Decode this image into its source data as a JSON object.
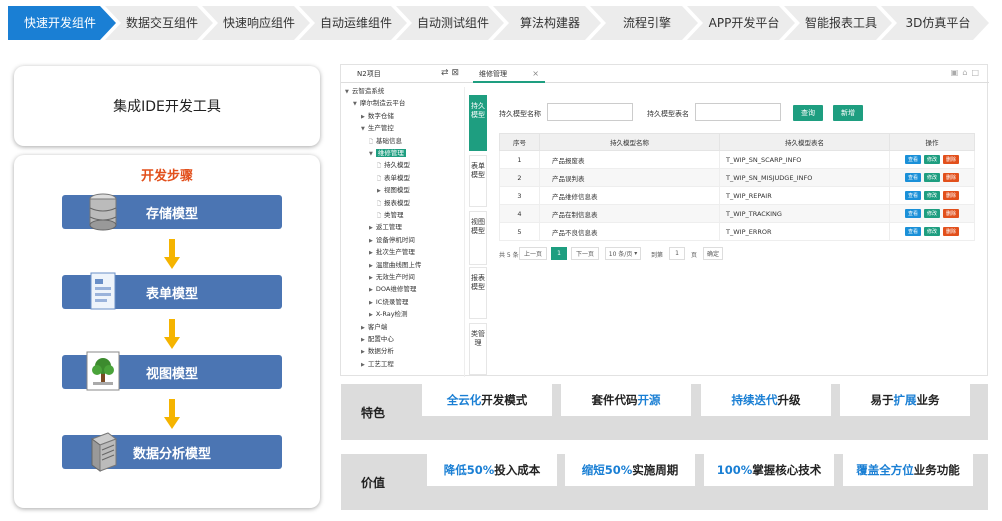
{
  "steps": [
    "快速开发组件",
    "数据交互组件",
    "快速响应组件",
    "自动运维组件",
    "自动测试组件",
    "算法构建器",
    "流程引擎",
    "APP开发平台",
    "智能报表工具",
    "3D仿真平台"
  ],
  "ide_tool": "集成IDE开发工具",
  "dev_steps": {
    "title": "开发步骤",
    "items": [
      "存储模型",
      "表单模型",
      "视图模型",
      "数据分析模型"
    ]
  },
  "ide": {
    "tree_header": "N2项目",
    "tree": [
      {
        "label": "云智造系统",
        "indent": 0,
        "arrow": "▼"
      },
      {
        "label": "摩尔制造云平台",
        "indent": 1,
        "arrow": "▼"
      },
      {
        "label": "数字仓储",
        "indent": 2,
        "arrow": "▶"
      },
      {
        "label": "生产管控",
        "indent": 2,
        "arrow": "▼"
      },
      {
        "label": "基础信息",
        "indent": 3,
        "arrow": "🗋"
      },
      {
        "label": "维修管理",
        "indent": 3,
        "arrow": "▼",
        "selected": true
      },
      {
        "label": "持久模型",
        "indent": 4,
        "arrow": "🗋"
      },
      {
        "label": "表单模型",
        "indent": 4,
        "arrow": "🗋"
      },
      {
        "label": "视图模型",
        "indent": 4,
        "arrow": "▶"
      },
      {
        "label": "报表模型",
        "indent": 4,
        "arrow": "🗋"
      },
      {
        "label": "类管理",
        "indent": 4,
        "arrow": "🗋"
      },
      {
        "label": "返工管理",
        "indent": 3,
        "arrow": "▶"
      },
      {
        "label": "设备停机时间",
        "indent": 3,
        "arrow": "▶"
      },
      {
        "label": "批次生产管理",
        "indent": 3,
        "arrow": "▶"
      },
      {
        "label": "温度曲线图上传",
        "indent": 3,
        "arrow": "▶"
      },
      {
        "label": "无效生产时间",
        "indent": 3,
        "arrow": "▶"
      },
      {
        "label": "DOA维修管理",
        "indent": 3,
        "arrow": "▶"
      },
      {
        "label": "IC烧录管理",
        "indent": 3,
        "arrow": "▶"
      },
      {
        "label": "X-Ray检测",
        "indent": 3,
        "arrow": "▶"
      },
      {
        "label": "客户端",
        "indent": 2,
        "arrow": "▶"
      },
      {
        "label": "配置中心",
        "indent": 2,
        "arrow": "▶"
      },
      {
        "label": "数据分析",
        "indent": 2,
        "arrow": "▶"
      },
      {
        "label": "工艺工程",
        "indent": 2,
        "arrow": "▶"
      }
    ],
    "tab": "维修管理",
    "vtabs": [
      "持久模型",
      "表单模型",
      "视图模型",
      "报表模型",
      "类管理"
    ],
    "query": {
      "name_label": "持久模型名称",
      "table_label": "持久模型表名",
      "search_btn": "查询",
      "add_btn": "新增"
    },
    "columns": [
      "序号",
      "持久模型名称",
      "持久模型表名",
      "操作"
    ],
    "rows": [
      {
        "no": "1",
        "name": "产品报废表",
        "table": "T_WIP_SN_SCARP_INFO"
      },
      {
        "no": "2",
        "name": "产品误判表",
        "table": "T_WIP_SN_MISJUDGE_INFO"
      },
      {
        "no": "3",
        "name": "产品维修信息表",
        "table": "T_WIP_REPAIR"
      },
      {
        "no": "4",
        "name": "产品在制信息表",
        "table": "T_WIP_TRACKING"
      },
      {
        "no": "5",
        "name": "产品不良信息表",
        "table": "T_WIP_ERROR"
      }
    ],
    "ops": {
      "view": "查看",
      "edit": "修改",
      "del": "删除"
    },
    "pager": {
      "total": "共 5 条",
      "prev": "上一页",
      "page": "1",
      "next": "下一页",
      "size": "10 条/页",
      "goto": "到第",
      "input": "1",
      "unit": "页",
      "confirm": "确定"
    }
  },
  "features": {
    "label": "特色",
    "items": [
      {
        "hl": "全云化",
        "rest": "开发模式",
        "order": "hl-first"
      },
      {
        "pre": "套件代码",
        "hl": "开源",
        "order": "hl-last"
      },
      {
        "hl": "持续迭代",
        "rest": "升级",
        "order": "hl-first"
      },
      {
        "pre": "易于",
        "hl": "扩展",
        "rest": "业务",
        "order": "mid"
      }
    ]
  },
  "values": {
    "label": "价值",
    "items": [
      {
        "pre": "",
        "hl": "降低50%",
        "rest": "投入成本"
      },
      {
        "pre": "",
        "hl": "缩短50%",
        "rest": "实施周期"
      },
      {
        "pre": "",
        "hl": "100%",
        "rest": "掌握核心技术"
      },
      {
        "pre": "",
        "hl": "覆盖全方位",
        "rest": "业务功能"
      }
    ]
  },
  "colors": {
    "primary": "#1a7fd4",
    "teal": "#1e9e80",
    "accent": "#e2501c",
    "box": "#4b75b3"
  }
}
